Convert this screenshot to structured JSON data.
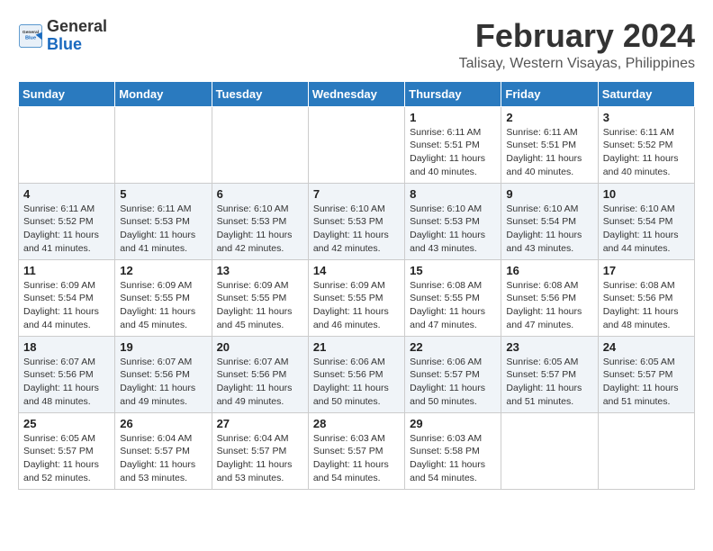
{
  "header": {
    "logo_general": "General",
    "logo_blue": "Blue",
    "month_title": "February 2024",
    "location": "Talisay, Western Visayas, Philippines"
  },
  "weekdays": [
    "Sunday",
    "Monday",
    "Tuesday",
    "Wednesday",
    "Thursday",
    "Friday",
    "Saturday"
  ],
  "weeks": [
    [
      {
        "day": "",
        "info": ""
      },
      {
        "day": "",
        "info": ""
      },
      {
        "day": "",
        "info": ""
      },
      {
        "day": "",
        "info": ""
      },
      {
        "day": "1",
        "info": "Sunrise: 6:11 AM\nSunset: 5:51 PM\nDaylight: 11 hours\nand 40 minutes."
      },
      {
        "day": "2",
        "info": "Sunrise: 6:11 AM\nSunset: 5:51 PM\nDaylight: 11 hours\nand 40 minutes."
      },
      {
        "day": "3",
        "info": "Sunrise: 6:11 AM\nSunset: 5:52 PM\nDaylight: 11 hours\nand 40 minutes."
      }
    ],
    [
      {
        "day": "4",
        "info": "Sunrise: 6:11 AM\nSunset: 5:52 PM\nDaylight: 11 hours\nand 41 minutes."
      },
      {
        "day": "5",
        "info": "Sunrise: 6:11 AM\nSunset: 5:53 PM\nDaylight: 11 hours\nand 41 minutes."
      },
      {
        "day": "6",
        "info": "Sunrise: 6:10 AM\nSunset: 5:53 PM\nDaylight: 11 hours\nand 42 minutes."
      },
      {
        "day": "7",
        "info": "Sunrise: 6:10 AM\nSunset: 5:53 PM\nDaylight: 11 hours\nand 42 minutes."
      },
      {
        "day": "8",
        "info": "Sunrise: 6:10 AM\nSunset: 5:53 PM\nDaylight: 11 hours\nand 43 minutes."
      },
      {
        "day": "9",
        "info": "Sunrise: 6:10 AM\nSunset: 5:54 PM\nDaylight: 11 hours\nand 43 minutes."
      },
      {
        "day": "10",
        "info": "Sunrise: 6:10 AM\nSunset: 5:54 PM\nDaylight: 11 hours\nand 44 minutes."
      }
    ],
    [
      {
        "day": "11",
        "info": "Sunrise: 6:09 AM\nSunset: 5:54 PM\nDaylight: 11 hours\nand 44 minutes."
      },
      {
        "day": "12",
        "info": "Sunrise: 6:09 AM\nSunset: 5:55 PM\nDaylight: 11 hours\nand 45 minutes."
      },
      {
        "day": "13",
        "info": "Sunrise: 6:09 AM\nSunset: 5:55 PM\nDaylight: 11 hours\nand 45 minutes."
      },
      {
        "day": "14",
        "info": "Sunrise: 6:09 AM\nSunset: 5:55 PM\nDaylight: 11 hours\nand 46 minutes."
      },
      {
        "day": "15",
        "info": "Sunrise: 6:08 AM\nSunset: 5:55 PM\nDaylight: 11 hours\nand 47 minutes."
      },
      {
        "day": "16",
        "info": "Sunrise: 6:08 AM\nSunset: 5:56 PM\nDaylight: 11 hours\nand 47 minutes."
      },
      {
        "day": "17",
        "info": "Sunrise: 6:08 AM\nSunset: 5:56 PM\nDaylight: 11 hours\nand 48 minutes."
      }
    ],
    [
      {
        "day": "18",
        "info": "Sunrise: 6:07 AM\nSunset: 5:56 PM\nDaylight: 11 hours\nand 48 minutes."
      },
      {
        "day": "19",
        "info": "Sunrise: 6:07 AM\nSunset: 5:56 PM\nDaylight: 11 hours\nand 49 minutes."
      },
      {
        "day": "20",
        "info": "Sunrise: 6:07 AM\nSunset: 5:56 PM\nDaylight: 11 hours\nand 49 minutes."
      },
      {
        "day": "21",
        "info": "Sunrise: 6:06 AM\nSunset: 5:56 PM\nDaylight: 11 hours\nand 50 minutes."
      },
      {
        "day": "22",
        "info": "Sunrise: 6:06 AM\nSunset: 5:57 PM\nDaylight: 11 hours\nand 50 minutes."
      },
      {
        "day": "23",
        "info": "Sunrise: 6:05 AM\nSunset: 5:57 PM\nDaylight: 11 hours\nand 51 minutes."
      },
      {
        "day": "24",
        "info": "Sunrise: 6:05 AM\nSunset: 5:57 PM\nDaylight: 11 hours\nand 51 minutes."
      }
    ],
    [
      {
        "day": "25",
        "info": "Sunrise: 6:05 AM\nSunset: 5:57 PM\nDaylight: 11 hours\nand 52 minutes."
      },
      {
        "day": "26",
        "info": "Sunrise: 6:04 AM\nSunset: 5:57 PM\nDaylight: 11 hours\nand 53 minutes."
      },
      {
        "day": "27",
        "info": "Sunrise: 6:04 AM\nSunset: 5:57 PM\nDaylight: 11 hours\nand 53 minutes."
      },
      {
        "day": "28",
        "info": "Sunrise: 6:03 AM\nSunset: 5:57 PM\nDaylight: 11 hours\nand 54 minutes."
      },
      {
        "day": "29",
        "info": "Sunrise: 6:03 AM\nSunset: 5:58 PM\nDaylight: 11 hours\nand 54 minutes."
      },
      {
        "day": "",
        "info": ""
      },
      {
        "day": "",
        "info": ""
      }
    ]
  ]
}
